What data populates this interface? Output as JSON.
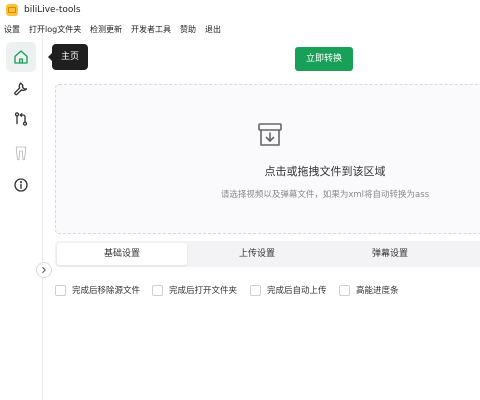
{
  "window": {
    "title": "biliLive-tools"
  },
  "menu": [
    "设置",
    "打开log文件夹",
    "检测更新",
    "开发者工具",
    "赞助",
    "退出"
  ],
  "sidebar": {
    "items": [
      {
        "icon": "home-icon",
        "tooltip": "主页",
        "active": true
      },
      {
        "icon": "wrench-icon"
      },
      {
        "icon": "git-compare-icon"
      },
      {
        "icon": "legs-icon"
      },
      {
        "icon": "info-icon"
      }
    ]
  },
  "toolbar": {
    "convert_label": "立即转换"
  },
  "dropzone": {
    "title": "点击或拖拽文件到该区域",
    "hint": "请选择视频以及弹幕文件，如果为xml将自动转换为ass"
  },
  "tabs": [
    {
      "label": "基础设置",
      "active": true
    },
    {
      "label": "上传设置",
      "active": false
    },
    {
      "label": "弹幕设置",
      "active": false
    }
  ],
  "options": [
    {
      "label": "完成后移除源文件",
      "checked": false
    },
    {
      "label": "完成后打开文件夹",
      "checked": false
    },
    {
      "label": "完成后自动上传",
      "checked": false
    },
    {
      "label": "高能进度条",
      "checked": false
    }
  ],
  "colors": {
    "accent": "#18a058",
    "tooltip_bg": "#1f1f1f"
  }
}
